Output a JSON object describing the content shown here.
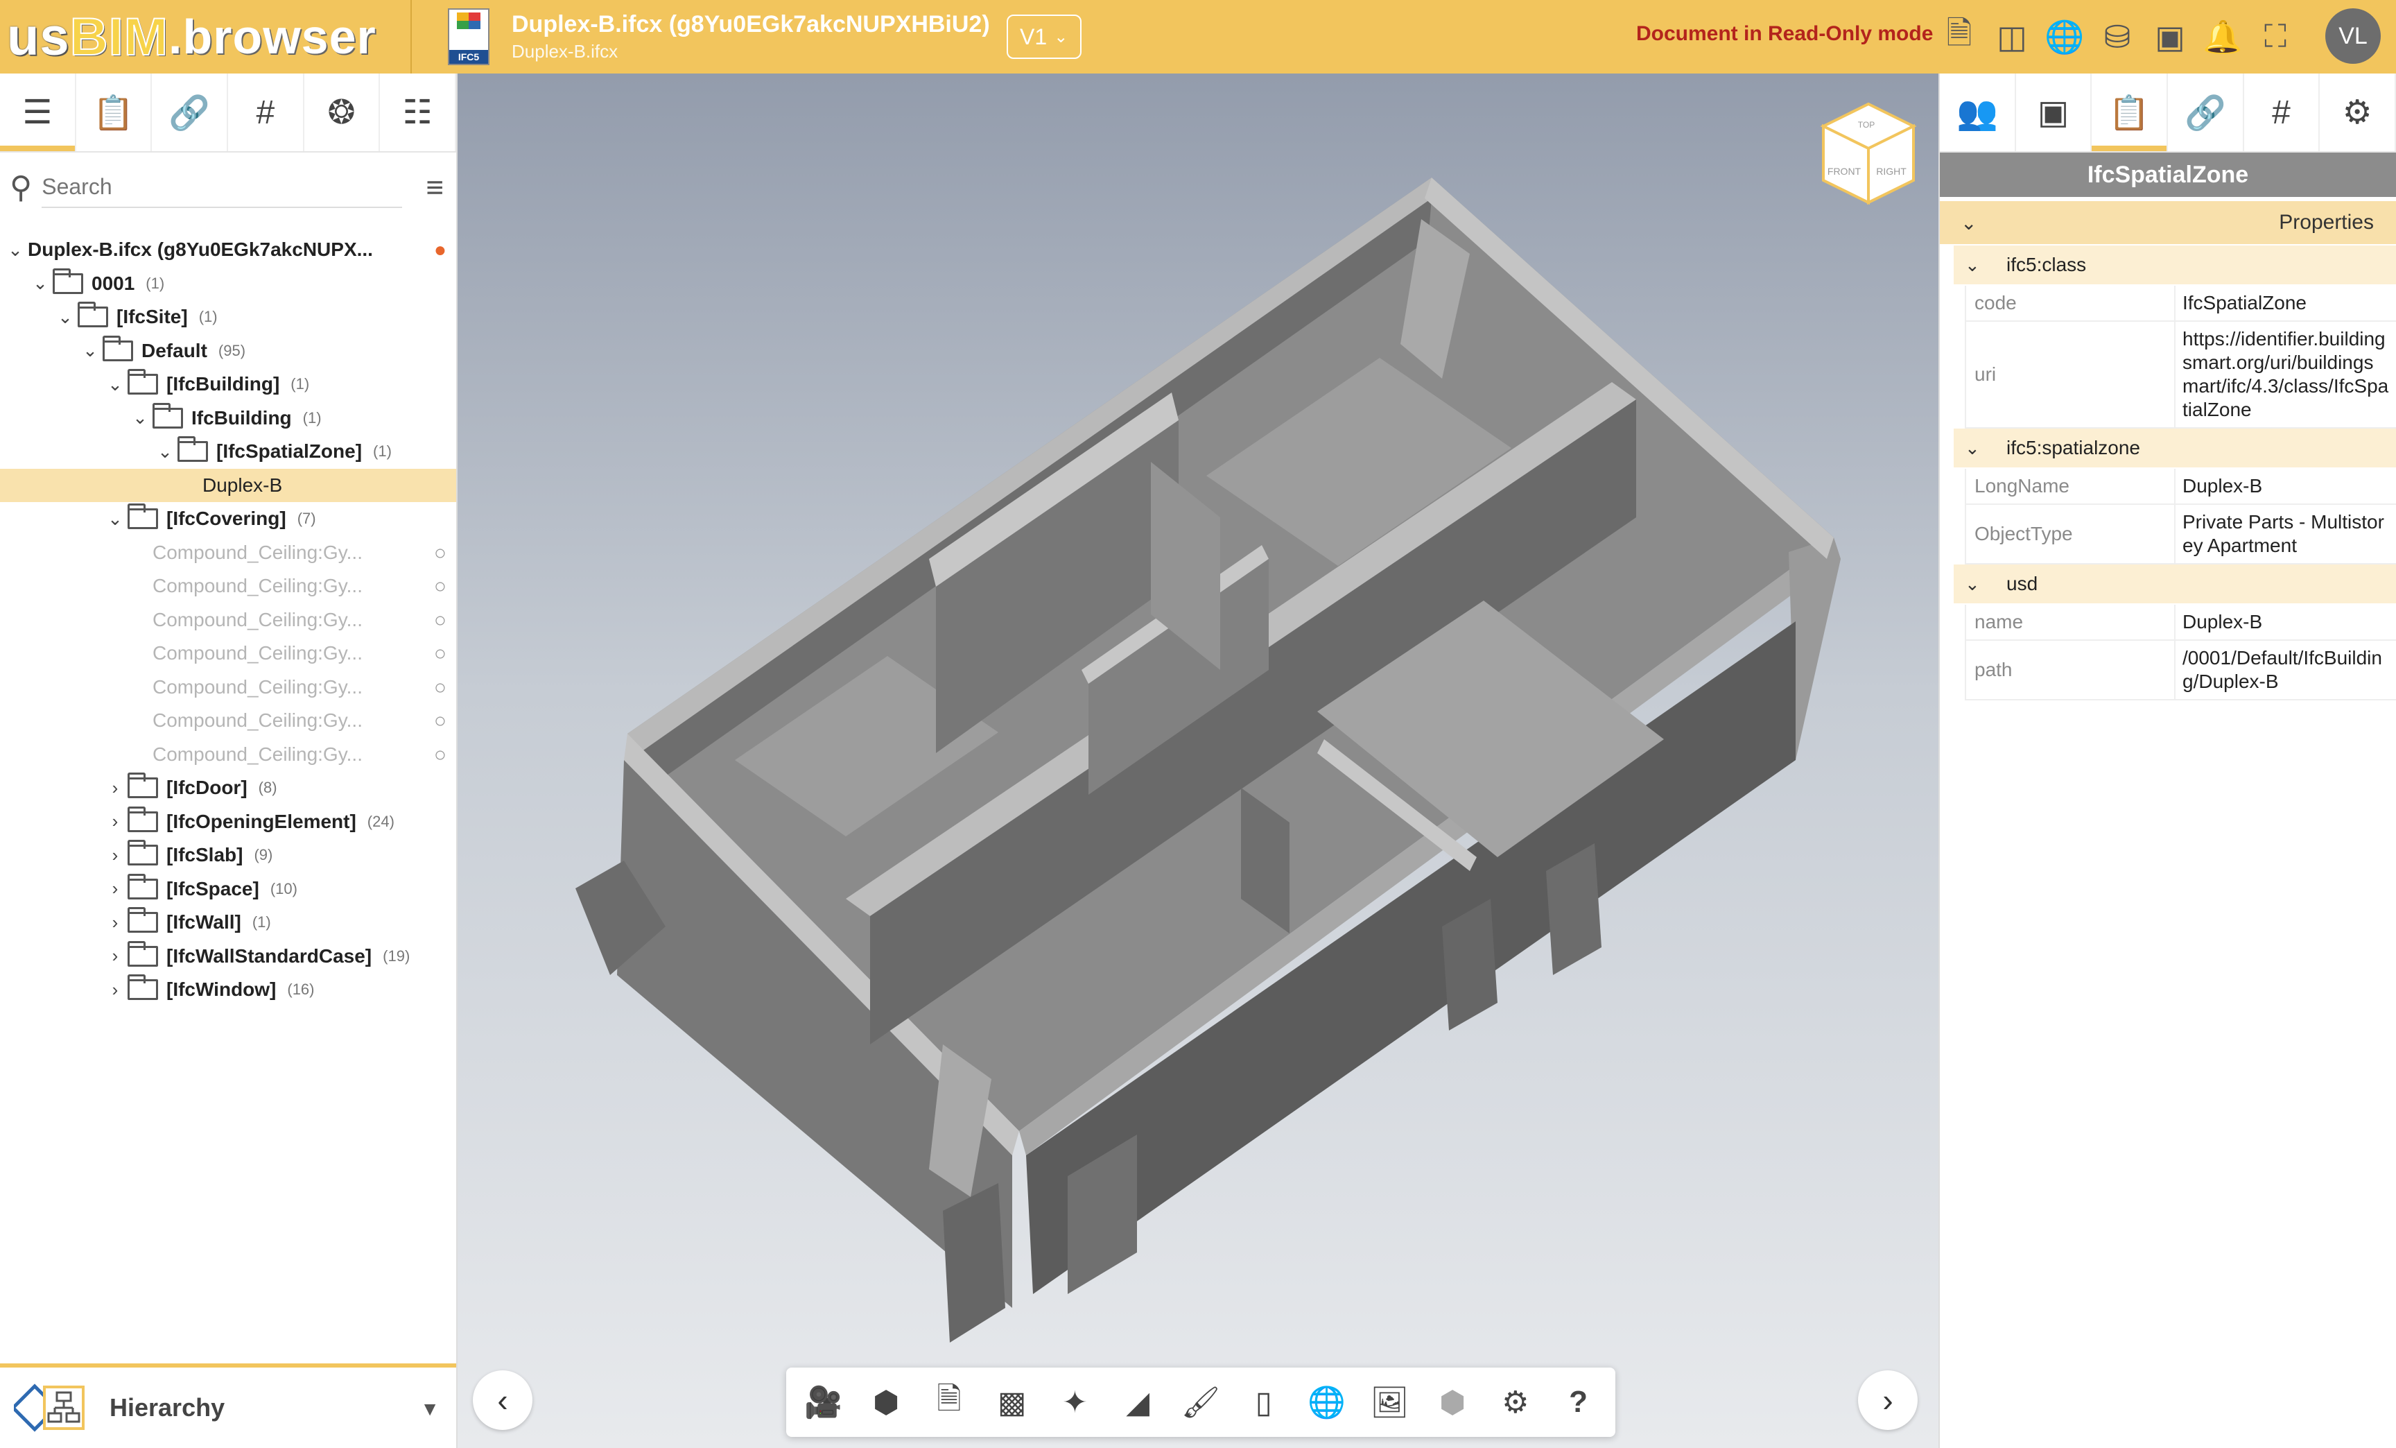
{
  "header": {
    "logo_us": "us",
    "logo_bim": "BIM",
    "logo_rest": ".browser",
    "ifc_badge_label": "IFC5",
    "doc_title": "Duplex-B.ifcx (g8Yu0EGk7akcNUPXHBiU2)",
    "doc_subtitle": "Duplex-B.ifcx",
    "version_label": "V1",
    "readonly_text": "Document in Read-Only mode",
    "icons": [
      "documents-icon",
      "compare-icon",
      "globe-icon",
      "database-icon",
      "layers-icon",
      "bell-icon",
      "fullscreen-icon"
    ],
    "avatar_initials": "VL"
  },
  "left_panel": {
    "tabs": [
      "hierarchy-icon",
      "checklist-icon",
      "link-icon",
      "hash-icon",
      "aperture-icon",
      "tree-list-icon"
    ],
    "search_placeholder": "Search",
    "tree": [
      {
        "indent": 0,
        "chevron": "v",
        "folder": false,
        "label": "Duplex-B.ifcx (g8Yu0EGk7akcNUPX...",
        "count": "",
        "bulb": "on"
      },
      {
        "indent": 1,
        "chevron": "v",
        "folder": true,
        "label": "0001",
        "count": "(1)"
      },
      {
        "indent": 2,
        "chevron": "v",
        "folder": true,
        "label": "[IfcSite]",
        "count": "(1)"
      },
      {
        "indent": 3,
        "chevron": "v",
        "folder": true,
        "label": "Default",
        "count": "(95)"
      },
      {
        "indent": 4,
        "chevron": "v",
        "folder": true,
        "label": "[IfcBuilding]",
        "count": "(1)"
      },
      {
        "indent": 5,
        "chevron": "v",
        "folder": true,
        "label": "IfcBuilding",
        "count": "(1)"
      },
      {
        "indent": 6,
        "chevron": "v",
        "folder": true,
        "label": "[IfcSpatialZone]",
        "count": "(1)"
      },
      {
        "indent": 7,
        "chevron": "",
        "folder": false,
        "label": "Duplex-B",
        "count": "",
        "selected": true,
        "leaf": true
      },
      {
        "indent": 4,
        "chevron": "v",
        "folder": true,
        "label": "[IfcCovering]",
        "count": "(7)"
      },
      {
        "indent": 5,
        "chevron": "",
        "folder": false,
        "label": "Compound_Ceiling:Gy...",
        "count": "",
        "dim": true,
        "bulb": "off"
      },
      {
        "indent": 5,
        "chevron": "",
        "folder": false,
        "label": "Compound_Ceiling:Gy...",
        "count": "",
        "dim": true,
        "bulb": "off"
      },
      {
        "indent": 5,
        "chevron": "",
        "folder": false,
        "label": "Compound_Ceiling:Gy...",
        "count": "",
        "dim": true,
        "bulb": "off"
      },
      {
        "indent": 5,
        "chevron": "",
        "folder": false,
        "label": "Compound_Ceiling:Gy...",
        "count": "",
        "dim": true,
        "bulb": "off"
      },
      {
        "indent": 5,
        "chevron": "",
        "folder": false,
        "label": "Compound_Ceiling:Gy...",
        "count": "",
        "dim": true,
        "bulb": "off"
      },
      {
        "indent": 5,
        "chevron": "",
        "folder": false,
        "label": "Compound_Ceiling:Gy...",
        "count": "",
        "dim": true,
        "bulb": "off"
      },
      {
        "indent": 5,
        "chevron": "",
        "folder": false,
        "label": "Compound_Ceiling:Gy...",
        "count": "",
        "dim": true,
        "bulb": "off"
      },
      {
        "indent": 4,
        "chevron": ">",
        "folder": true,
        "label": "[IfcDoor]",
        "count": "(8)"
      },
      {
        "indent": 4,
        "chevron": ">",
        "folder": true,
        "label": "[IfcOpeningElement]",
        "count": "(24)"
      },
      {
        "indent": 4,
        "chevron": ">",
        "folder": true,
        "label": "[IfcSlab]",
        "count": "(9)"
      },
      {
        "indent": 4,
        "chevron": ">",
        "folder": true,
        "label": "[IfcSpace]",
        "count": "(10)"
      },
      {
        "indent": 4,
        "chevron": ">",
        "folder": true,
        "label": "[IfcWall]",
        "count": "(1)"
      },
      {
        "indent": 4,
        "chevron": ">",
        "folder": true,
        "label": "[IfcWallStandardCase]",
        "count": "(19)"
      },
      {
        "indent": 4,
        "chevron": ">",
        "folder": true,
        "label": "[IfcWindow]",
        "count": "(16)"
      }
    ],
    "hierarchy_label": "Hierarchy"
  },
  "viewer": {
    "navcube_front": "FRONT",
    "navcube_right": "RIGHT",
    "navcube_top": "TOP",
    "toolbar": [
      "camera-icon",
      "cube-icon",
      "document-pin-icon",
      "section-box-icon",
      "axes-icon",
      "measure-icon",
      "brush-icon",
      "pipe-icon",
      "globe-icon",
      "image-icon",
      "hatch-cube-icon",
      "settings-icon",
      "help-icon"
    ]
  },
  "right_panel": {
    "tabs": [
      "people-icon",
      "cursor-box-icon",
      "checklist-icon",
      "link-icon",
      "hash-icon",
      "gear-person-icon"
    ],
    "heading": "IfcSpatialZone",
    "properties_label": "Properties",
    "groups": [
      {
        "name": "ifc5:class",
        "props": [
          {
            "key": "code",
            "value": "IfcSpatialZone"
          },
          {
            "key": "uri",
            "value": "https://identifier.buildingsmart.org/uri/buildingsmart/ifc/4.3/class/IfcSpatialZone"
          }
        ]
      },
      {
        "name": "ifc5:spatialzone",
        "props": [
          {
            "key": "LongName",
            "value": "Duplex-B"
          },
          {
            "key": "ObjectType",
            "value": "Private Parts - Multistorey Apartment"
          }
        ]
      },
      {
        "name": "usd",
        "props": [
          {
            "key": "name",
            "value": "Duplex-B"
          },
          {
            "key": "path",
            "value": "/0001/Default/IfcBuilding/Duplex-B"
          }
        ]
      }
    ]
  },
  "colors": {
    "header_bg": "#f2c55d",
    "readonly_red": "#b3241c",
    "selected_row": "#f9e2ad"
  }
}
